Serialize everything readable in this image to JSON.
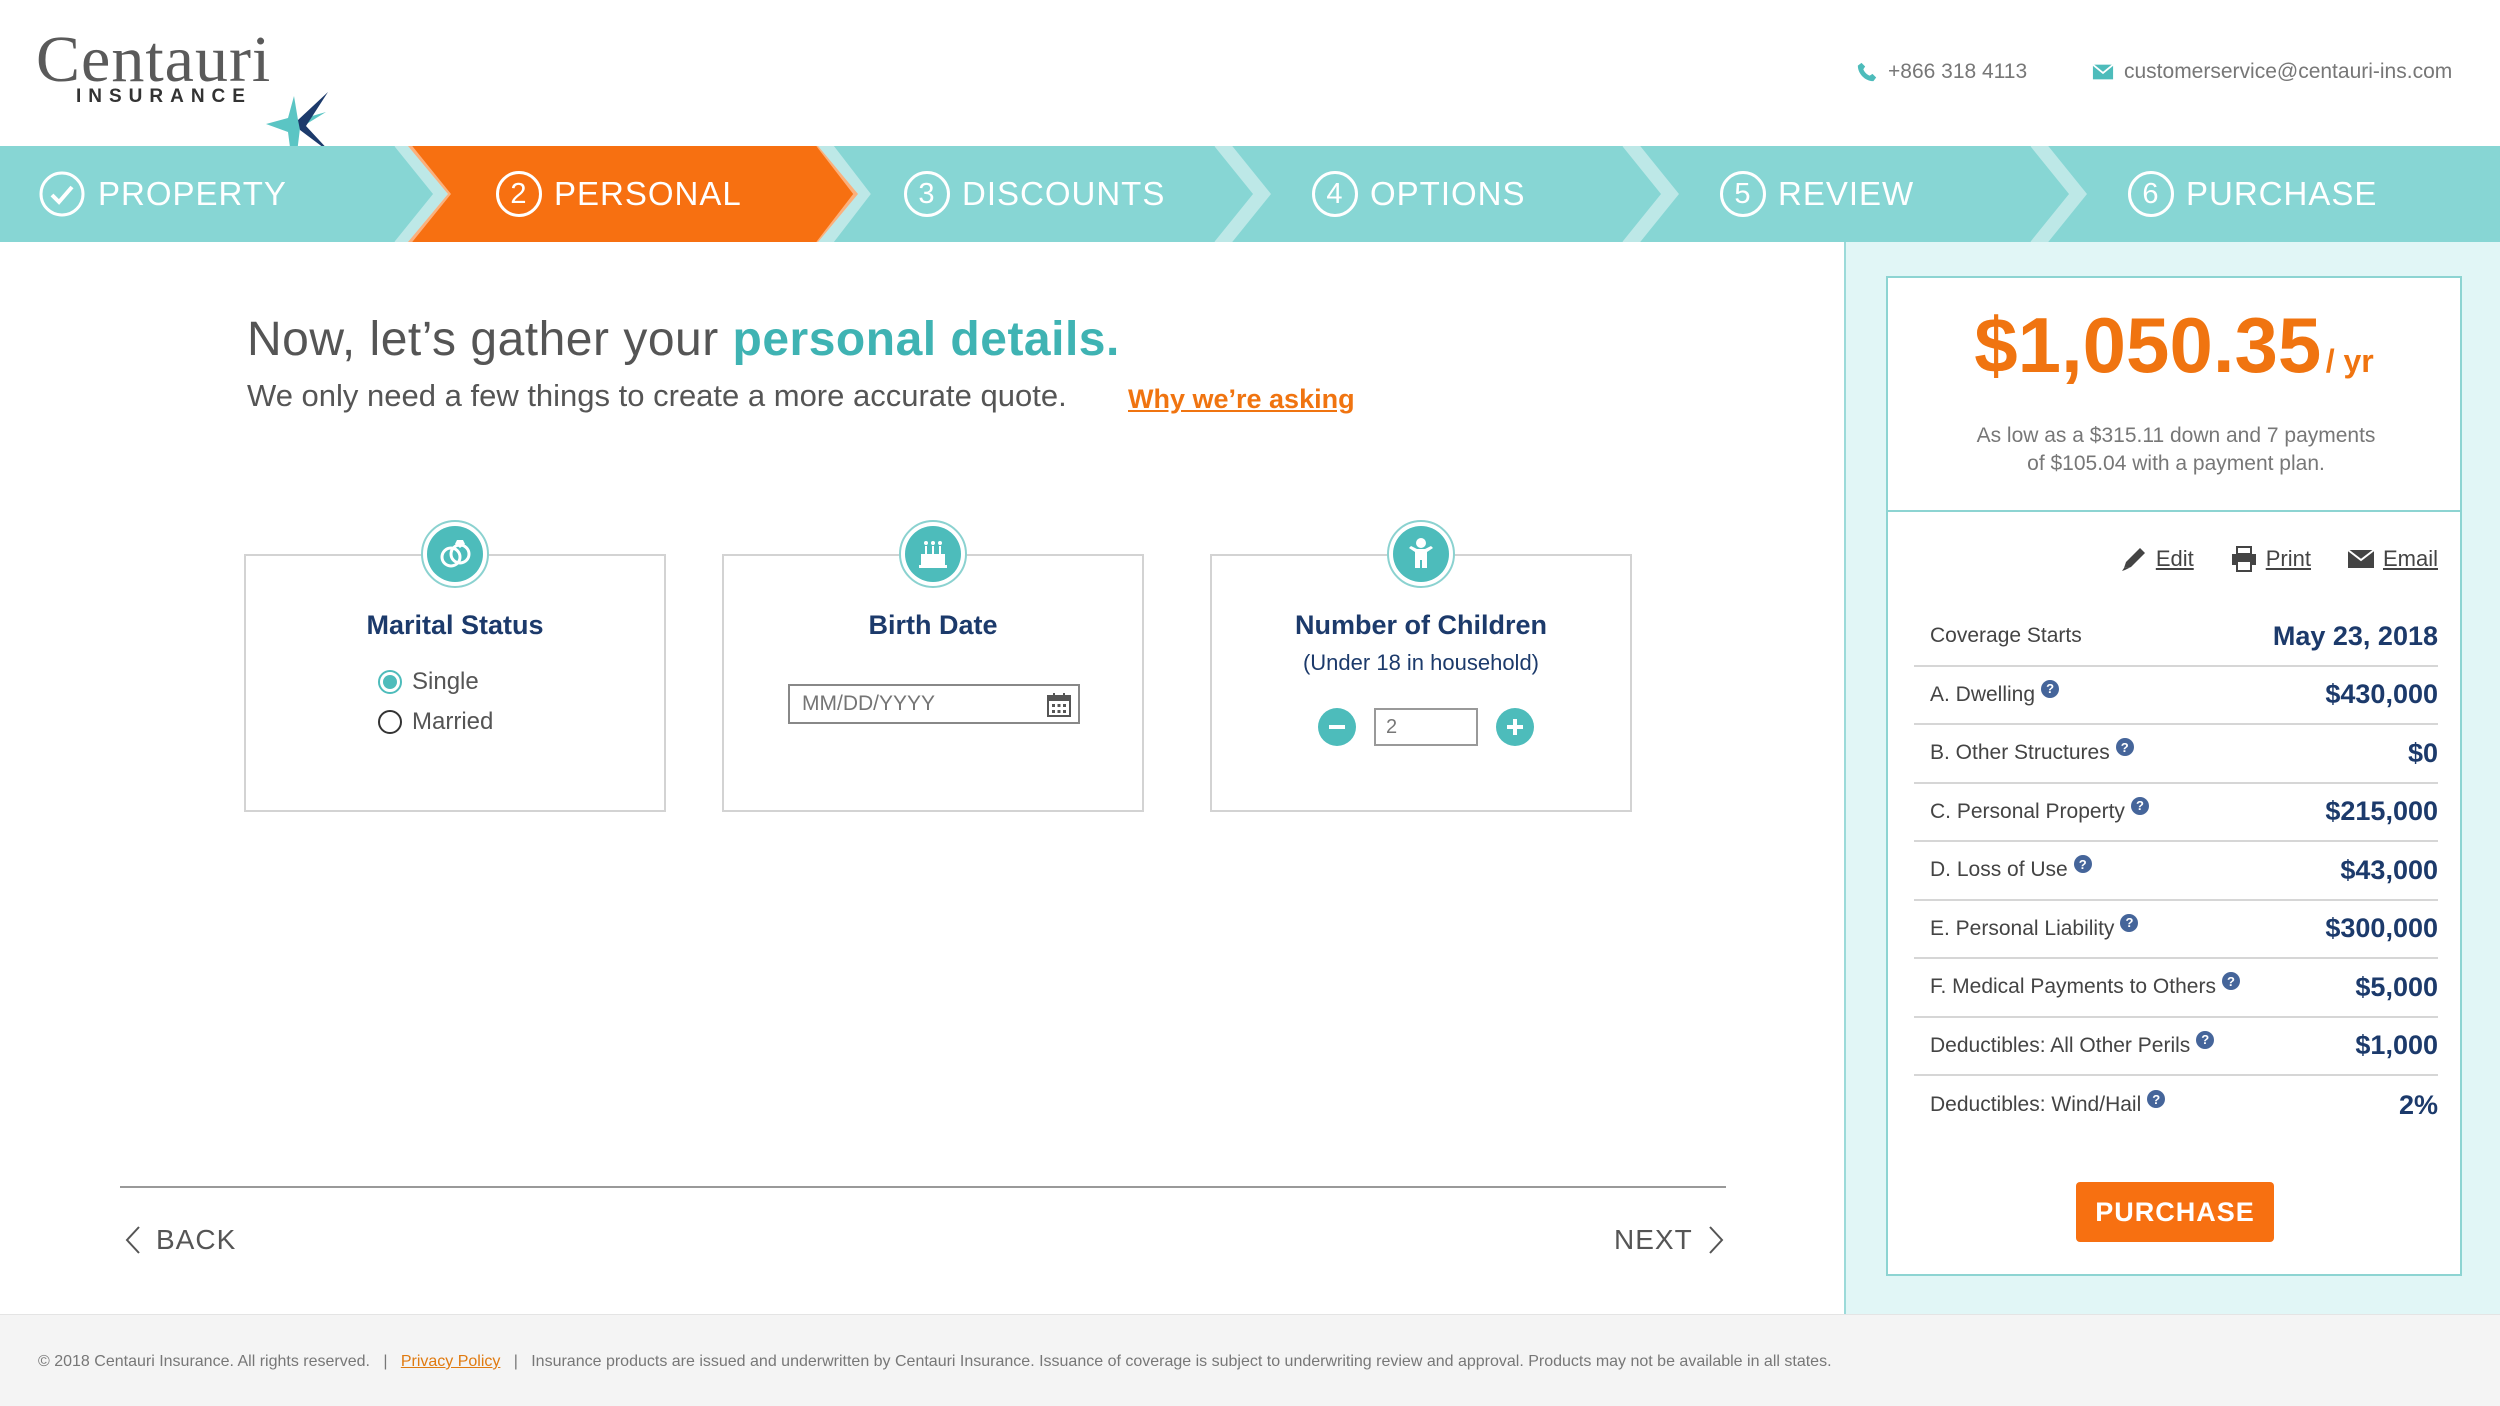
{
  "brand": {
    "name": "Centauri",
    "sub": "INSURANCE",
    "colors": {
      "teal": "#87d6d4",
      "accent_teal": "#4dbcbb",
      "orange": "#f07410",
      "navy": "#1c3a6b"
    }
  },
  "contact": {
    "phone": "+866 318 4113",
    "email": "customerservice@centauri-ins.com",
    "phone_icon": "phone-icon",
    "email_icon": "envelope-icon"
  },
  "steps": [
    {
      "num": "",
      "label": "PROPERTY",
      "state": "completed"
    },
    {
      "num": "2",
      "label": "PERSONAL",
      "state": "active"
    },
    {
      "num": "3",
      "label": "DISCOUNTS",
      "state": "upcoming"
    },
    {
      "num": "4",
      "label": "OPTIONS",
      "state": "upcoming"
    },
    {
      "num": "5",
      "label": "REVIEW",
      "state": "upcoming"
    },
    {
      "num": "6",
      "label": "PURCHASE",
      "state": "upcoming"
    }
  ],
  "main": {
    "headline_prefix": "Now, let’s gather your",
    "headline_accent": "personal details.",
    "subline": "We only need a few things to create a more accurate quote.",
    "why_link": "Why we’re asking",
    "marital": {
      "title": "Marital Status",
      "icon": "rings-icon",
      "options": [
        {
          "label": "Single",
          "selected": true
        },
        {
          "label": "Married",
          "selected": false
        }
      ]
    },
    "birth": {
      "title": "Birth Date",
      "icon": "birthday-cake-icon",
      "placeholder": "MM/DD/YYYY",
      "value": ""
    },
    "children": {
      "title": "Number of Children",
      "subtitle": "(Under 18 in household)",
      "icon": "child-icon",
      "value": "2"
    },
    "back_label": "BACK",
    "next_label": "NEXT"
  },
  "quote": {
    "price": "$1,050.35",
    "period": "/ yr",
    "note_line1": "As low as a $315.11 down and 7 payments",
    "note_line2": "of $105.04 with a payment plan.",
    "actions": {
      "edit": "Edit",
      "print": "Print",
      "email": "Email"
    },
    "rows": [
      {
        "label": "Coverage Starts",
        "value": "May 23, 2018",
        "help": false
      },
      {
        "label": "A. Dwelling",
        "value": "$430,000",
        "help": true
      },
      {
        "label": "B. Other Structures",
        "value": "$0",
        "help": true
      },
      {
        "label": "C. Personal Property",
        "value": "$215,000",
        "help": true
      },
      {
        "label": "D. Loss of Use",
        "value": "$43,000",
        "help": true
      },
      {
        "label": "E. Personal Liability",
        "value": "$300,000",
        "help": true
      },
      {
        "label": "F. Medical Payments to Others",
        "value": "$5,000",
        "help": true
      },
      {
        "label": "Deductibles: All Other Perils",
        "value": "$1,000",
        "help": true
      },
      {
        "label": "Deductibles: Wind/Hail",
        "value": "2%",
        "help": true
      }
    ],
    "purchase_label": "PURCHASE"
  },
  "footer": {
    "copyright": "© 2018 Centauri Insurance. All rights reserved.",
    "privacy": "Privacy Policy",
    "disclaimer": "Insurance products are issued and underwritten by Centauri Insurance.  Issuance of coverage is subject to underwriting review and approval. Products may not be available in all states."
  }
}
